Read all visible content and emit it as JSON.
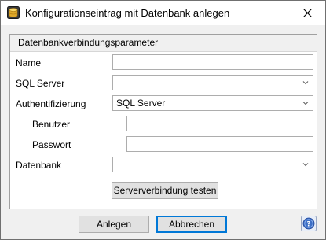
{
  "window": {
    "title": "Konfigurationseintrag mit Datenbank anlegen",
    "close_icon": "close-icon",
    "app_icon": "database-app-icon"
  },
  "group": {
    "title": "Datenbankverbindungsparameter"
  },
  "form": {
    "name_label": "Name",
    "name_value": "",
    "sql_server_label": "SQL Server",
    "sql_server_value": "",
    "auth_label": "Authentifizierung",
    "auth_value": "SQL Server",
    "user_label": "Benutzer",
    "user_value": "",
    "password_label": "Passwort",
    "password_value": "",
    "database_label": "Datenbank",
    "database_value": ""
  },
  "buttons": {
    "test_connection": "Serververbindung testen",
    "create": "Anlegen",
    "cancel": "Abbrechen",
    "help_icon": "help-icon"
  },
  "colors": {
    "accent": "#0078d7",
    "window_bg": "#f0f0f0",
    "panel_bg": "#ffffff"
  }
}
